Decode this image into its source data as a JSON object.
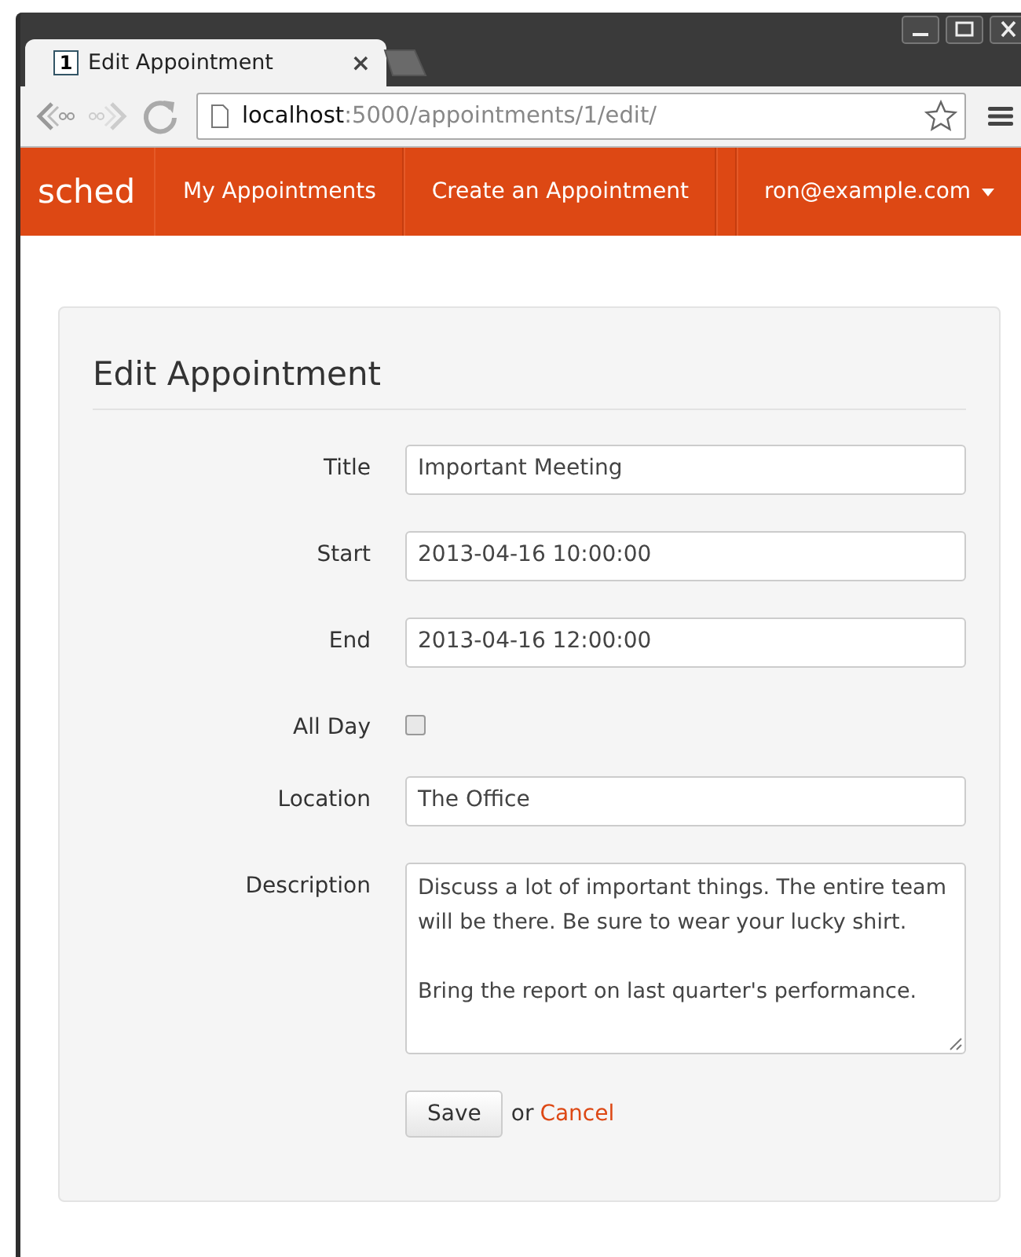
{
  "browser": {
    "tab": {
      "favicon": "1",
      "title": "Edit Appointment",
      "close": "×"
    },
    "address": {
      "host": "localhost",
      "path": ":5000/appointments/1/edit/"
    }
  },
  "navbar": {
    "brand": "sched",
    "links": [
      {
        "label": "My Appointments"
      },
      {
        "label": "Create an Appointment"
      }
    ],
    "user": "ron@example.com"
  },
  "form": {
    "heading": "Edit Appointment",
    "fields": [
      {
        "kind": "text",
        "label": "Title",
        "value": "Important Meeting"
      },
      {
        "kind": "text",
        "label": "Start",
        "value": "2013-04-16 10:00:00"
      },
      {
        "kind": "text",
        "label": "End",
        "value": "2013-04-16 12:00:00"
      },
      {
        "kind": "checkbox",
        "label": "All Day",
        "checked": false
      },
      {
        "kind": "text",
        "label": "Location",
        "value": "The Office"
      },
      {
        "kind": "textarea",
        "label": "Description",
        "value": "Discuss a lot of important things. The entire team will be there. Be sure to wear your lucky shirt.\n\nBring the report on last quarter's performance."
      }
    ],
    "save": "Save",
    "or": "or",
    "cancel": "Cancel"
  }
}
